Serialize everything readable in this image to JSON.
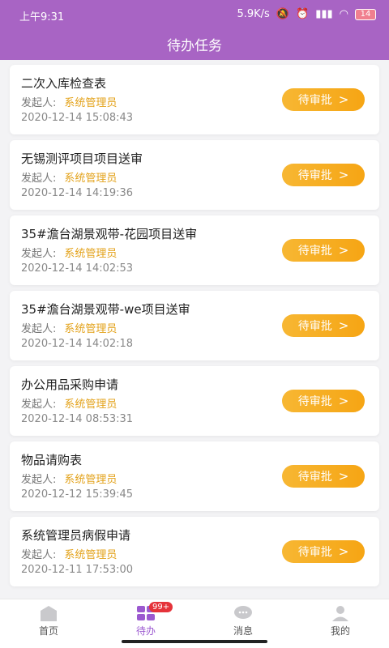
{
  "status_bar": {
    "time": "上午9:31",
    "speed": "5.9K/s",
    "battery": "14"
  },
  "header": {
    "title": "待办任务"
  },
  "tasks": [
    {
      "title": "二次入库检查表",
      "initiator_label": "发起人:",
      "initiator": "系统管理员",
      "time": "2020-12-14 15:08:43",
      "action": "待审批"
    },
    {
      "title": "无锡测评项目项目送审",
      "initiator_label": "发起人:",
      "initiator": "系统管理员",
      "time": "2020-12-14 14:19:36",
      "action": "待审批"
    },
    {
      "title": "35#澹台湖景观带-花园项目送审",
      "initiator_label": "发起人:",
      "initiator": "系统管理员",
      "time": "2020-12-14 14:02:53",
      "action": "待审批"
    },
    {
      "title": "35#澹台湖景观带-we项目送审",
      "initiator_label": "发起人:",
      "initiator": "系统管理员",
      "time": "2020-12-14 14:02:18",
      "action": "待审批"
    },
    {
      "title": "办公用品采购申请",
      "initiator_label": "发起人:",
      "initiator": "系统管理员",
      "time": "2020-12-14 08:53:31",
      "action": "待审批"
    },
    {
      "title": "物品请购表",
      "initiator_label": "发起人:",
      "initiator": "系统管理员",
      "time": "2020-12-12 15:39:45",
      "action": "待审批"
    },
    {
      "title": "系统管理员病假申请",
      "initiator_label": "发起人:",
      "initiator": "系统管理员",
      "time": "2020-12-11 17:53:00",
      "action": "待审批"
    }
  ],
  "tabs": [
    {
      "label": "首页",
      "icon": "home-icon"
    },
    {
      "label": "待办",
      "icon": "grid-icon",
      "badge": "99+"
    },
    {
      "label": "消息",
      "icon": "chat-icon"
    },
    {
      "label": "我的",
      "icon": "user-icon"
    }
  ],
  "colors": {
    "header": "#a864c4",
    "accent": "#f6a514",
    "active_tab": "#9b59d0",
    "badge": "#e5333a"
  }
}
